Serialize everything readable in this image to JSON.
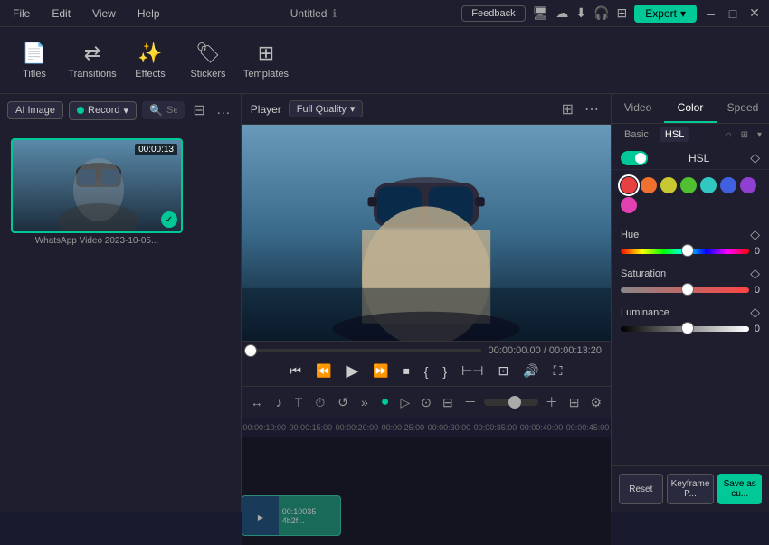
{
  "titlebar": {
    "title": "Untitled",
    "feedback_label": "Feedback",
    "export_label": "Export",
    "menu_items": [
      "File",
      "Edit",
      "View",
      "Help"
    ]
  },
  "toolbar": {
    "tools": [
      {
        "id": "titles",
        "icon": "📄",
        "label": "Titles"
      },
      {
        "id": "transitions",
        "icon": "⇄",
        "label": "Transitions"
      },
      {
        "id": "effects",
        "icon": "✨",
        "label": "Effects"
      },
      {
        "id": "stickers",
        "icon": "🏷",
        "label": "Stickers"
      },
      {
        "id": "templates",
        "icon": "⊞",
        "label": "Templates"
      }
    ]
  },
  "media_panel": {
    "ai_label": "AI Image",
    "record_label": "Record",
    "search_placeholder": "Search media",
    "media_items": [
      {
        "id": "video1",
        "label": "WhatsApp Video 2023-10-05...",
        "duration": "00:00:13",
        "selected": true
      }
    ]
  },
  "player": {
    "title": "Player",
    "quality": "Full Quality",
    "current_time": "00:00:00.00",
    "total_time": "00:00:13:20",
    "progress": 0
  },
  "right_panel": {
    "tabs": [
      "Video",
      "Color",
      "Speed"
    ],
    "active_tab": "Color",
    "sub_tabs": [
      "Basic",
      "HSL"
    ],
    "active_sub_tab": "HSL",
    "hsl_enabled": true,
    "hsl_label": "HSL",
    "color_dots": [
      {
        "color": "#e84040",
        "selected": true
      },
      {
        "color": "#f07030",
        "selected": false
      },
      {
        "color": "#c8c830",
        "selected": false
      },
      {
        "color": "#50c030",
        "selected": false
      },
      {
        "color": "#30c8c0",
        "selected": false
      },
      {
        "color": "#4060e0",
        "selected": false
      },
      {
        "color": "#9040d0",
        "selected": false
      },
      {
        "color": "#e040b0",
        "selected": false
      }
    ],
    "sliders": [
      {
        "id": "hue",
        "label": "Hue",
        "value": 0.0,
        "position": 52,
        "gradient": "hue"
      },
      {
        "id": "saturation",
        "label": "Saturation",
        "value": 0.0,
        "position": 52,
        "gradient": "sat"
      },
      {
        "id": "luminance",
        "label": "Luminance",
        "value": 0.0,
        "position": 52,
        "gradient": "lum"
      }
    ],
    "buttons": {
      "reset": "Reset",
      "keyframe": "Keyframe P...",
      "save": "Save as cu..."
    }
  },
  "timeline": {
    "ruler_marks": [
      "00:00:10:00",
      "00:00:15:00",
      "00:00:20:00",
      "00:00:25:00",
      "00:00:30:00",
      "00:00:35:00",
      "00:00:40:00",
      "00:00:45:00"
    ],
    "clip_label": "00:10035-4b2f..."
  }
}
